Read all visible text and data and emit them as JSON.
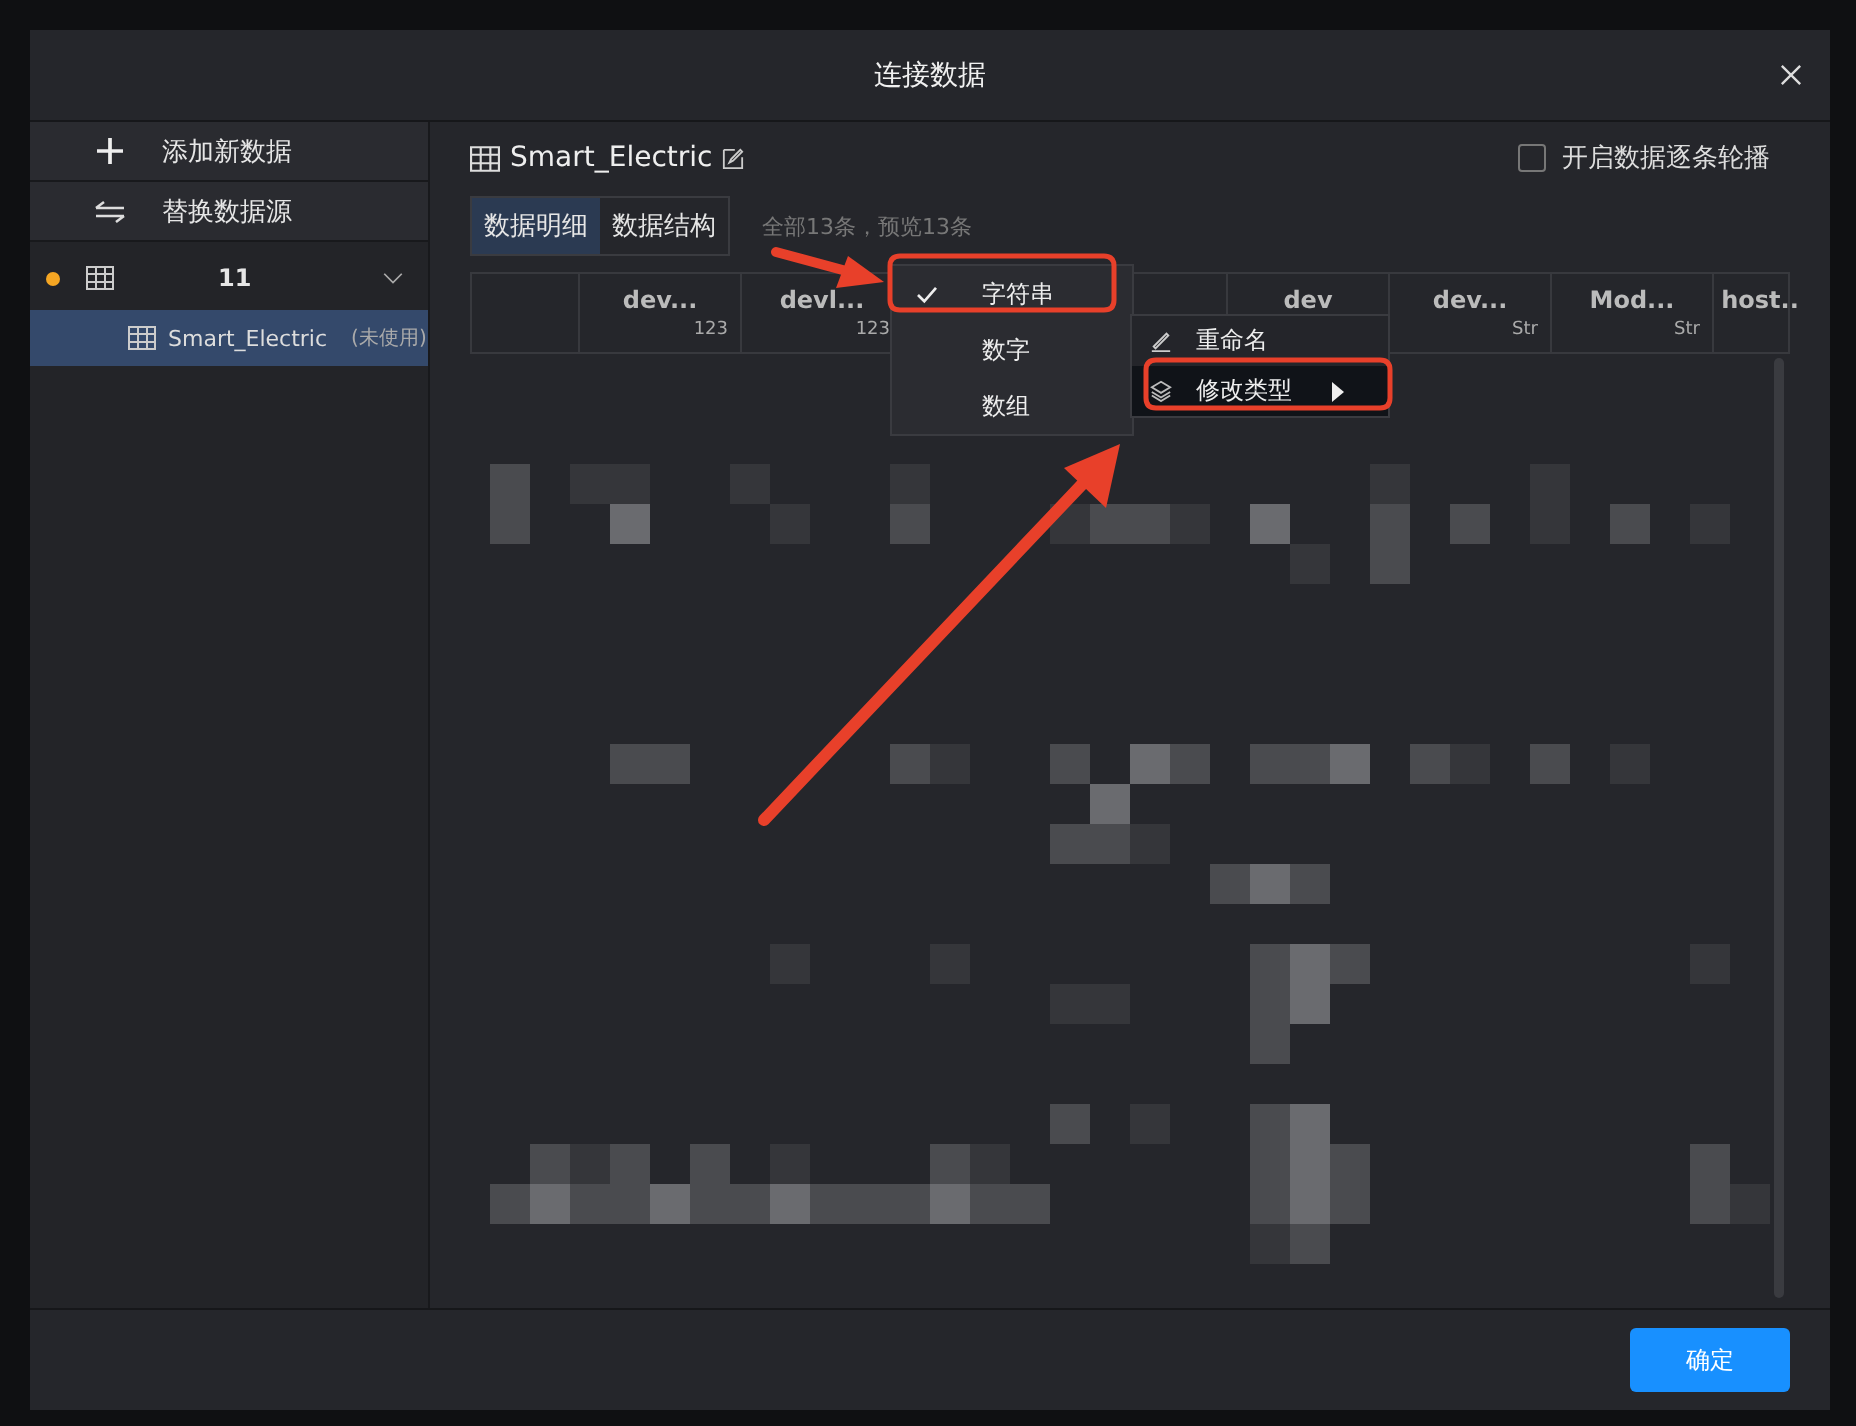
{
  "window": {
    "title": "连接数据"
  },
  "sidebar": {
    "actions": [
      {
        "kind": "add",
        "label": "添加新数据"
      },
      {
        "kind": "replace",
        "label": "替换数据源"
      }
    ],
    "groups": [
      {
        "label": "11",
        "expanded": true,
        "children": [
          {
            "label": "Smart_Electric",
            "note": "(未使用)",
            "selected": true
          }
        ]
      }
    ]
  },
  "main": {
    "title": "Smart_Electric",
    "carousel": {
      "label": "开启数据逐条轮播",
      "checked": false
    },
    "tabs": [
      {
        "label": "数据明细",
        "selected": true
      },
      {
        "label": "数据结构",
        "selected": false
      }
    ],
    "summary": "全部13条，预览13条",
    "columns": [
      {
        "label": "dev...",
        "type": "123"
      },
      {
        "label": "devl...",
        "type": "123"
      },
      {},
      {},
      {
        "label": "dev"
      },
      {
        "label": "dev...",
        "type": "Str"
      },
      {
        "label": "Mod...",
        "type": "Str"
      },
      {
        "label": "host.."
      }
    ],
    "type_menu": [
      {
        "label": "字符串",
        "checked": true
      },
      {
        "label": "数字",
        "checked": false
      },
      {
        "label": "数组",
        "checked": false
      }
    ],
    "column_menu": [
      {
        "kind": "rename",
        "label": "重命名",
        "highlighted": false
      },
      {
        "kind": "change-type",
        "label": "修改类型",
        "highlighted": true
      }
    ]
  },
  "buttons": [
    {
      "label": "确定"
    }
  ]
}
